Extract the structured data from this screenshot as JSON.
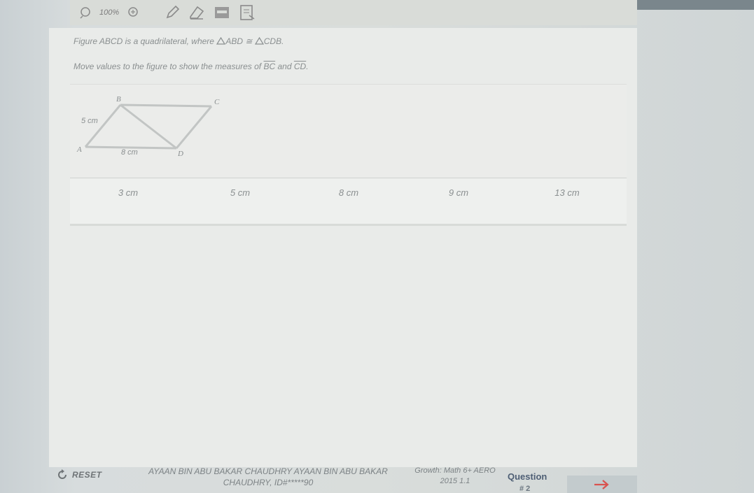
{
  "toolbar": {
    "zoom": "100%"
  },
  "prompt": {
    "line1_before": "Figure ABCD is a quadrilateral, where ",
    "line1_tri1": "ABD",
    "line1_cong": " ≅ ",
    "line1_tri2": "CDB",
    "line1_end": ".",
    "line2_before": "Move values to the figure to show the measures of ",
    "seg1": "BC",
    "line2_and": " and ",
    "seg2": "CD",
    "line2_end": "."
  },
  "figure": {
    "vertices": {
      "A": "A",
      "B": "B",
      "C": "C",
      "D": "D"
    },
    "label_ab": "5 cm",
    "label_ad": "8 cm"
  },
  "tiles": [
    "3 cm",
    "5 cm",
    "8 cm",
    "9 cm",
    "13 cm"
  ],
  "footer": {
    "reset": "RESET",
    "student_line1": "AYAAN BIN ABU BAKAR CHAUDHRY AYAAN BIN ABU BAKAR",
    "student_line2": "CHAUDHRY, ID#*****90",
    "test_line1": "Growth: Math 6+ AERO",
    "test_line2": "2015 1.1",
    "question_label": "Question",
    "question_number": "# 2"
  },
  "colors": {
    "panel": "#e9ebe9",
    "accent": "#4e5f75",
    "arrow": "#d9534f"
  }
}
